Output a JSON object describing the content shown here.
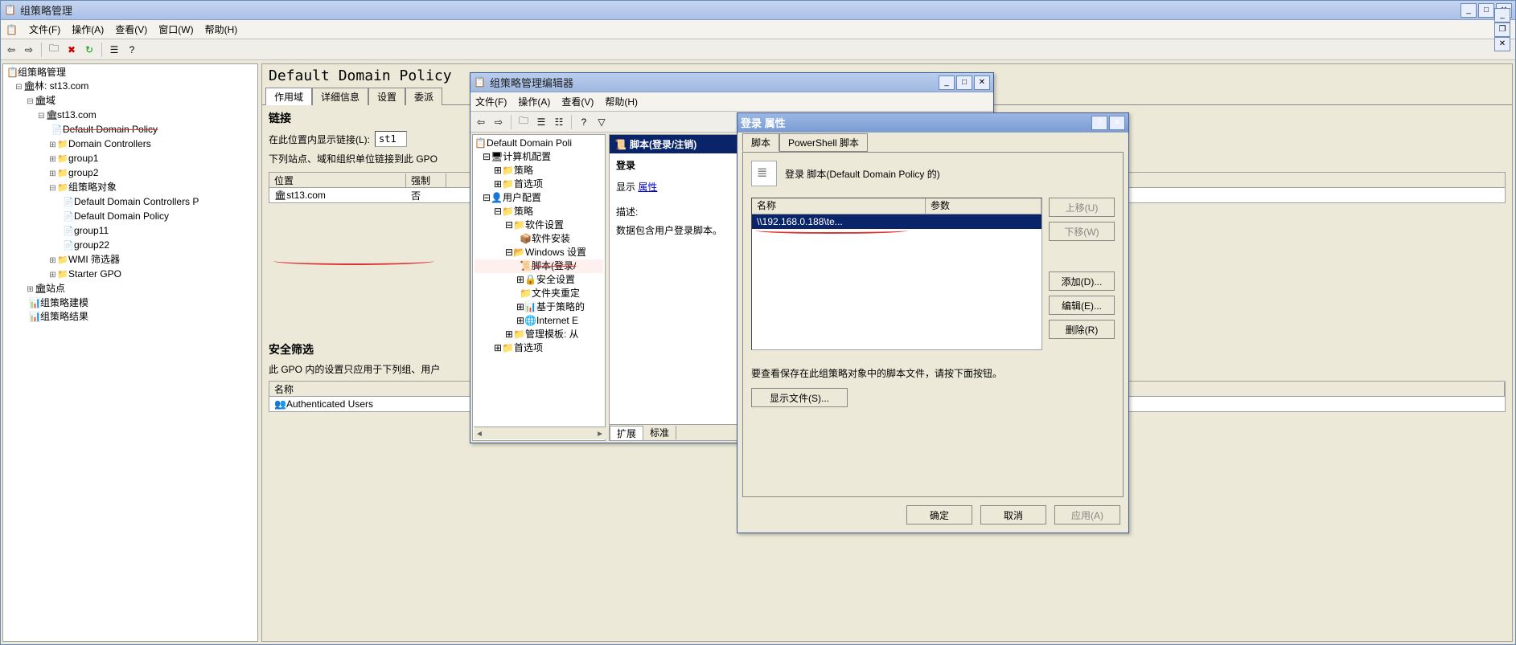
{
  "app": {
    "title": "组策略管理",
    "menus": [
      "文件(F)",
      "操作(A)",
      "查看(V)",
      "窗口(W)",
      "帮助(H)"
    ]
  },
  "tree": {
    "root": "组策略管理",
    "forest": "林: st13.com",
    "domains_label": "域",
    "domain": "st13.com",
    "items": [
      "Default Domain Policy",
      "Domain Controllers",
      "group1",
      "group2"
    ],
    "gpo_container": "组策略对象",
    "gpo_items": [
      "Default Domain Controllers P",
      "Default Domain Policy",
      "group11",
      "group22"
    ],
    "wmi": "WMI 筛选器",
    "starter": "Starter GPO",
    "sites": "站点",
    "modeling": "组策略建模",
    "results": "组策略结果"
  },
  "result": {
    "title": "Default Domain Policy",
    "tabs": [
      "作用域",
      "详细信息",
      "设置",
      "委派"
    ],
    "links_heading": "链接",
    "links_label": "在此位置内显示链接(L):",
    "links_value": "st1",
    "links_desc": "下列站点、域和组织单位链接到此 GPO",
    "cols": {
      "loc": "位置",
      "enf": "强制"
    },
    "row": {
      "loc": "st13.com",
      "enf": "否"
    },
    "secfilt_heading": "安全筛选",
    "secfilt_desc": "此 GPO 内的设置只应用于下列组、用户",
    "secfilt_col": "名称",
    "secfilt_row": "Authenticated Users"
  },
  "editor": {
    "title": "组策略管理编辑器",
    "menus": [
      "文件(F)",
      "操作(A)",
      "查看(V)",
      "帮助(H)"
    ],
    "root": "Default Domain Poli",
    "comp_cfg": "计算机配置",
    "policy": "策略",
    "pref": "首选项",
    "user_cfg": "用户配置",
    "soft": "软件设置",
    "soft_install": "软件安装",
    "win": "Windows 设置",
    "script": "脚本(登录/",
    "sec": "安全设置",
    "dedup": "文件夹重定",
    "qos": "基于策略的",
    "ie": "Internet E",
    "admtmpl": "管理模板: 从",
    "detail_header": "脚本(登录/注销)",
    "detail_sub": "登录",
    "show_label": "显示",
    "show_link": "属性",
    "desc_label": "描述:",
    "desc_text": "数据包含用户登录脚本。",
    "ext_tab": "扩展",
    "std_tab": "标准"
  },
  "prop": {
    "title": "登录 属性",
    "tabs": [
      "脚本",
      "PowerShell 脚本"
    ],
    "heading": "登录 脚本(Default Domain Policy 的)",
    "cols": {
      "name": "名称",
      "param": "参数"
    },
    "row_name": "\\\\192.168.0.188\\te...",
    "btn_up": "上移(U)",
    "btn_down": "下移(W)",
    "btn_add": "添加(D)...",
    "btn_edit": "编辑(E)...",
    "btn_del": "删除(R)",
    "note": "要查看保存在此组策略对象中的脚本文件，请按下面按钮。",
    "btn_show": "显示文件(S)...",
    "ok": "确定",
    "cancel": "取消",
    "apply": "应用(A)"
  }
}
